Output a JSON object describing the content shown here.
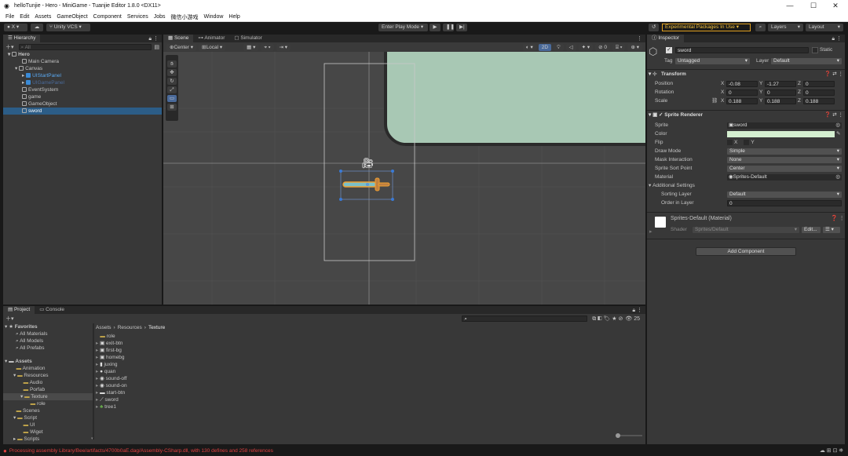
{
  "window": {
    "title": "helloTunjie - Hero - MiniGame - Tuanjie Editor 1.8.0 <DX11>"
  },
  "menu": [
    "File",
    "Edit",
    "Assets",
    "GameObject",
    "Component",
    "Services",
    "Jobs",
    "微信小游戏",
    "Window",
    "Help"
  ],
  "toolbar": {
    "account": "X",
    "vcs": "Unity VCS",
    "play_mode": "Enter Play Mode",
    "experimental": "Experimental Packages In Use",
    "layers": "Layers",
    "layout": "Layout"
  },
  "hierarchy": {
    "tab": "Hierarchy",
    "search_placeholder": "All",
    "items": [
      {
        "label": "Hero",
        "depth": 0
      },
      {
        "label": "Main Camera",
        "depth": 2
      },
      {
        "label": "Canvas",
        "depth": 1
      },
      {
        "label": "UIStartPanel",
        "depth": 2
      },
      {
        "label": "UIGamePanel",
        "depth": 2
      },
      {
        "label": "EventSystem",
        "depth": 2
      },
      {
        "label": "game",
        "depth": 2
      },
      {
        "label": "GameObject",
        "depth": 2
      },
      {
        "label": "sword",
        "depth": 2
      }
    ]
  },
  "scene": {
    "tabs": [
      "Scene",
      "Animator",
      "Simulator"
    ],
    "pivot": "Center",
    "space": "Local",
    "mode2d": "2D"
  },
  "inspector": {
    "tab": "Inspector",
    "object_name": "sword",
    "static_label": "Static",
    "tag_label": "Tag",
    "tag": "Untagged",
    "layer_label": "Layer",
    "layer": "Default",
    "transform": {
      "title": "Transform",
      "position_label": "Position",
      "rotation_label": "Rotation",
      "scale_label": "Scale",
      "position": [
        "-0.08",
        "-1.27",
        "0"
      ],
      "rotation": [
        "0",
        "0",
        "0"
      ],
      "scale": [
        "0.188",
        "0.188",
        "0.188"
      ],
      "axes": [
        "X",
        "Y",
        "Z"
      ]
    },
    "sprite_renderer": {
      "title": "Sprite Renderer",
      "sprite_label": "Sprite",
      "sprite": "sword",
      "color_label": "Color",
      "color": "#d4efd0",
      "flip_label": "Flip",
      "flip_x": "X",
      "flip_y": "Y",
      "draw_mode_label": "Draw Mode",
      "draw_mode": "Simple",
      "mask_label": "Mask Interaction",
      "mask": "None",
      "sort_point_label": "Sprite Sort Point",
      "sort_point": "Center",
      "material_label": "Material",
      "material": "Sprites-Default",
      "additional": "Additional Settings",
      "sorting_layer_label": "Sorting Layer",
      "sorting_layer": "Default",
      "order_label": "Order in Layer",
      "order": "0"
    },
    "material_block": {
      "name": "Sprites-Default (Material)",
      "shader_label": "Shader",
      "shader": "Sprites/Default",
      "edit": "Edit...",
      "list": "☰"
    },
    "add_component": "Add Component"
  },
  "project": {
    "tabs": [
      "Project",
      "Console"
    ],
    "count": "25",
    "favorites_title": "Favorites",
    "favorites": [
      "All Materials",
      "All Models",
      "All Prefabs"
    ],
    "assets_title": "Assets",
    "tree": [
      {
        "label": "Animation",
        "depth": 1
      },
      {
        "label": "Resources",
        "depth": 1
      },
      {
        "label": "Audio",
        "depth": 2
      },
      {
        "label": "Porfab",
        "depth": 2
      },
      {
        "label": "Texture",
        "depth": 2,
        "selected": true
      },
      {
        "label": "role",
        "depth": 3
      },
      {
        "label": "Scenes",
        "depth": 1
      },
      {
        "label": "Script",
        "depth": 1
      },
      {
        "label": "UI",
        "depth": 2
      },
      {
        "label": "Wiget",
        "depth": 2
      },
      {
        "label": "Scripts",
        "depth": 1
      }
    ],
    "breadcrumb": [
      "Assets",
      "Resources",
      "Texture"
    ],
    "files": [
      "role",
      "exit-btn",
      "first-bg",
      "homebg",
      "juxing",
      "quan",
      "sound-off",
      "sound-on",
      "start-btn",
      "sword",
      "tree1"
    ]
  },
  "status": {
    "message": "Processing assembly Library/Bee/artifacts/4700b0aE.dag/Assembly-CSharp.dll, with 130 defines and 258 references"
  },
  "colors": {
    "accent": "#2c5d87",
    "panel": "#383838",
    "scene_bg": "#474747",
    "green_rect": "#a8c8b4",
    "warn": "#f0c040",
    "error": "#e04040"
  }
}
